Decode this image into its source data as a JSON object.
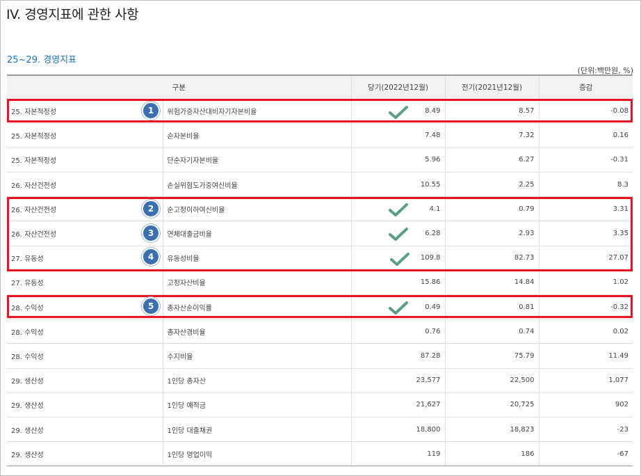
{
  "title": "IV. 경영지표에 관한 사항",
  "section": "25~29. 경영지표",
  "unit": "(단위:백만원, %)",
  "headers": [
    "구분",
    "당기(2022년12월)",
    "전기(2021년12월)",
    "증감"
  ],
  "rows": [
    {
      "cat": "25. 자본적정성",
      "item": "위험가중자산대비자기자본비율",
      "cur": "8.49",
      "prev": "8.57",
      "diff": "-0.08"
    },
    {
      "cat": "25. 자본적정성",
      "item": "순자본비율",
      "cur": "7.48",
      "prev": "7.32",
      "diff": "0.16"
    },
    {
      "cat": "25. 자본적정성",
      "item": "단순자기자본비율",
      "cur": "5.96",
      "prev": "6.27",
      "diff": "-0.31"
    },
    {
      "cat": "26. 자산건전성",
      "item": "손실위험도가중여신비율",
      "cur": "10.55",
      "prev": "2.25",
      "diff": "8.3"
    },
    {
      "cat": "26. 자산건전성",
      "item": "순고정이하여신비율",
      "cur": "4.1",
      "prev": "0.79",
      "diff": "3.31"
    },
    {
      "cat": "26. 자산건전성",
      "item": "연체대출금비율",
      "cur": "6.28",
      "prev": "2.93",
      "diff": "3.35"
    },
    {
      "cat": "27. 유동성",
      "item": "유동성비율",
      "cur": "109.8",
      "prev": "82.73",
      "diff": "27.07"
    },
    {
      "cat": "27. 유동성",
      "item": "고정자산비율",
      "cur": "15.86",
      "prev": "14.84",
      "diff": "1.02"
    },
    {
      "cat": "28. 수익성",
      "item": "총자산순이익률",
      "cur": "0.49",
      "prev": "0.81",
      "diff": "-0.32"
    },
    {
      "cat": "28. 수익성",
      "item": "총자산경비율",
      "cur": "0.76",
      "prev": "0.74",
      "diff": "0.02"
    },
    {
      "cat": "28. 수익성",
      "item": "수지비율",
      "cur": "87.28",
      "prev": "75.79",
      "diff": "11.49"
    },
    {
      "cat": "29. 생산성",
      "item": "1인당 총자산",
      "cur": "23,577",
      "prev": "22,500",
      "diff": "1,077"
    },
    {
      "cat": "29. 생산성",
      "item": "1인당 예적금",
      "cur": "21,627",
      "prev": "20,725",
      "diff": "902"
    },
    {
      "cat": "29. 생산성",
      "item": "1인당 대출채권",
      "cur": "18,800",
      "prev": "18,823",
      "diff": "-23"
    },
    {
      "cat": "29. 생산성",
      "item": "1인당 영업이익",
      "cur": "119",
      "prev": "186",
      "diff": "-67"
    }
  ],
  "badges": [
    "1",
    "2",
    "3",
    "4",
    "5"
  ],
  "colors": {
    "highlight": "#e8131f",
    "badge": "#3a6fb0",
    "check": "#5a9e8a",
    "section": "#1a73b8"
  }
}
